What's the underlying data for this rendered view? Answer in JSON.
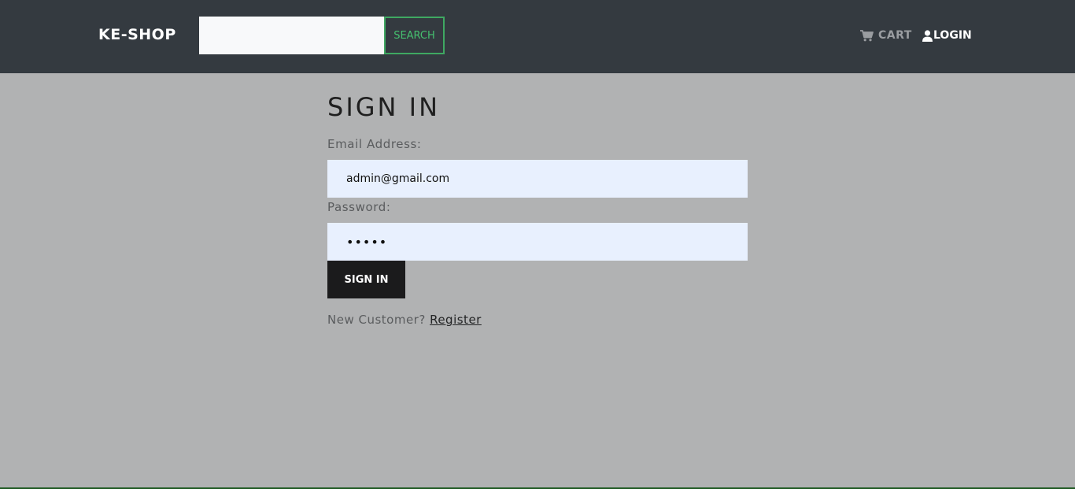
{
  "header": {
    "brand": "KE-SHOP",
    "search": {
      "placeholder": "",
      "value": "",
      "button_label": "SEARCH"
    },
    "nav": {
      "cart_label": "CART",
      "cart_icon": "shopping-cart-icon",
      "login_label": "LOGIN",
      "login_icon": "user-icon"
    }
  },
  "main": {
    "title": "SIGN IN",
    "email_label": "Email Address:",
    "email_value": "admin@gmail.com",
    "password_label": "Password:",
    "password_value": "•••••",
    "submit_label": "SIGN IN",
    "new_customer_text": "New Customer? ",
    "register_label": "Register"
  },
  "colors": {
    "navbar": "#343a40",
    "page_background": "#b1b2b3",
    "search_accent": "#45c06f",
    "input_fill": "#e8f0fe",
    "button_dark": "#1b1b1c"
  }
}
